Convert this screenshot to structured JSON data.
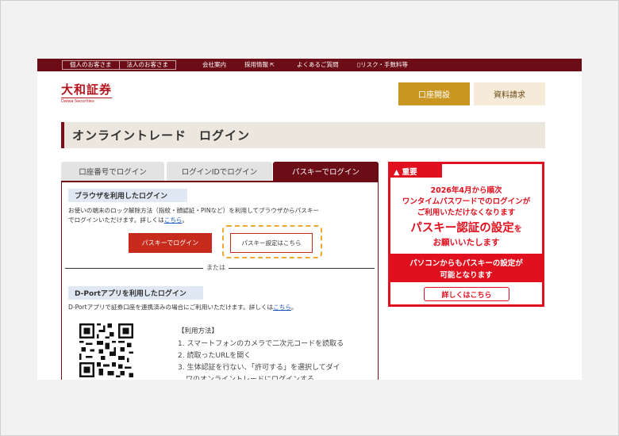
{
  "topbar": {
    "segment_individual": "個人のお客さま",
    "segment_corporate": "法人のお客さま",
    "company": "会社案内",
    "recruit": "採用情報",
    "faq": "よくあるご質問",
    "risk": "リスク・手数料等"
  },
  "header": {
    "logo_jp": "大和証券",
    "logo_en": "Daiwa Securities",
    "open_account": "口座開設",
    "request_docs": "資料請求"
  },
  "page_title": "オンライントレード　ログイン",
  "tabs": [
    {
      "label": "口座番号でログイン"
    },
    {
      "label": "ログインIDでログイン"
    },
    {
      "label": "パスキーでログイン"
    }
  ],
  "browser_section": {
    "heading": "ブラウザを利用したログイン",
    "desc_line1": "お使いの端末のロック解除方法（指紋・顔認証・PINなど）を利用してブラウザからパスキー",
    "desc_line2": "でログインいただけます。詳しくは",
    "desc_link": "こちら",
    "desc_end": "。",
    "login_button": "パスキーでログイン",
    "settings_button": "パスキー設定はこちら"
  },
  "separator": "または",
  "app_section": {
    "heading": "D-Portアプリを利用したログイン",
    "desc": "D-Portアプリで証券口座を連携済みの場合にご利用いただけます。詳しくは",
    "desc_link": "こちら",
    "desc_end": "。",
    "usage_heading": "【利用方法】",
    "steps": [
      "1. スマートフォンのカメラで二次元コードを読取る",
      "2. 読取ったURLを開く",
      "3. 生体認証を行ない、「許可する」を選択してダイ",
      "ワのオンライントレードにログインする"
    ]
  },
  "notice": {
    "badge": "▲ 重要",
    "line1": "2026年4月から順次",
    "line2": "ワンタイムパスワードでのログインが",
    "line3": "ご利用いただけなくなります",
    "big_main": "パスキー認証の設定",
    "big_suffix": "を",
    "line5": "お願いいたします",
    "white1": "パソコンからもパスキーの設定が",
    "white2": "可能となります",
    "button": "詳しくはこちら"
  },
  "colors": {
    "brand": "#6b0c16",
    "accent_red": "#e0101e",
    "gold": "#c9961f",
    "highlight_dash": "#f0a830"
  }
}
